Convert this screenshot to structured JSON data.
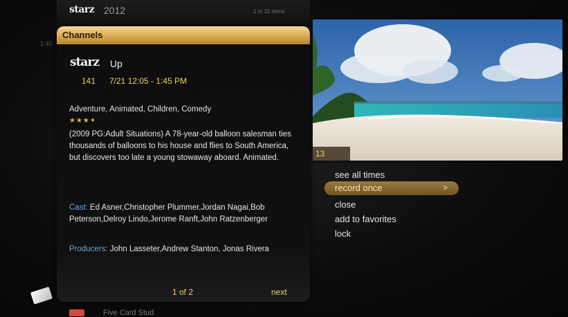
{
  "top": {
    "network": "starz",
    "year": "2012",
    "count": "1 to 15 items"
  },
  "left_time": "1:45",
  "panel": {
    "header": "Channels",
    "network": "starz",
    "title": "Up",
    "channel": "141",
    "airtime": "7/21 12:05 - 1:45 PM",
    "genres": "Adventure, Animated, Children, Comedy",
    "stars": "★★★✦",
    "description": "(2009 PG:Adult Situations) A 78-year-old balloon salesman ties thousands of balloons to his house and flies to South America, but discovers too late a young stowaway aboard. Animated.",
    "cast_label": "Cast:",
    "cast": "Ed Asner,Christopher Plummer,Jordan Nagai,Bob Peterson,Delroy Lindo,Jerome Ranft,John Ratzenberger",
    "producers_label": "Producers:",
    "producers": "John Lasseter,Andrew Stanton, Jonas Rivera",
    "page": "1 of 2",
    "next": "next"
  },
  "bottom": {
    "title": "Five Card Stud"
  },
  "preview": {
    "channel": "13"
  },
  "menu": {
    "items": [
      "see all times",
      "record once",
      "close",
      "add to favorites",
      "lock"
    ],
    "selected_chevron": ">"
  },
  "colors": {
    "accent": "#f1cf62",
    "header": "#d8a84f",
    "link": "#6fa6d8"
  }
}
